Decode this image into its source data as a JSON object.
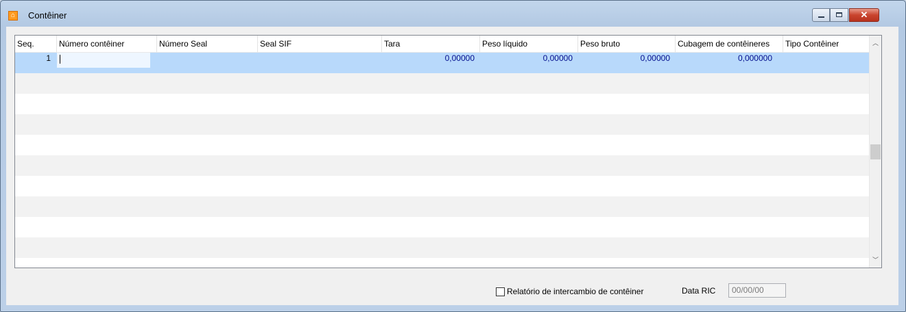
{
  "window": {
    "title": "Contêiner",
    "colors": {
      "frame": "#b9cee8",
      "close_button": "#c9442e",
      "selected_row": "#b8d9fb",
      "value_text": "#000c8c"
    }
  },
  "grid": {
    "columns": [
      "Seq.",
      "Número contêiner",
      "Número Seal",
      "Seal SIF",
      "Tara",
      "Peso líquido",
      "Peso bruto",
      "Cubagem de contêineres",
      "Tipo Contêiner"
    ],
    "rows": [
      {
        "seq": "1",
        "numero_conteiner": "",
        "numero_seal": "",
        "seal_sif": "",
        "tara": "0,00000",
        "peso_liquido": "0,00000",
        "peso_bruto": "0,00000",
        "cubagem": "0,000000",
        "tipo": ""
      }
    ],
    "scroll_position": 0.5
  },
  "footer": {
    "checkbox_label": "Relatório de intercambio de contêiner",
    "checkbox_checked": false,
    "data_ric_label": "Data RIC",
    "data_ric_value": "00/00/00"
  }
}
